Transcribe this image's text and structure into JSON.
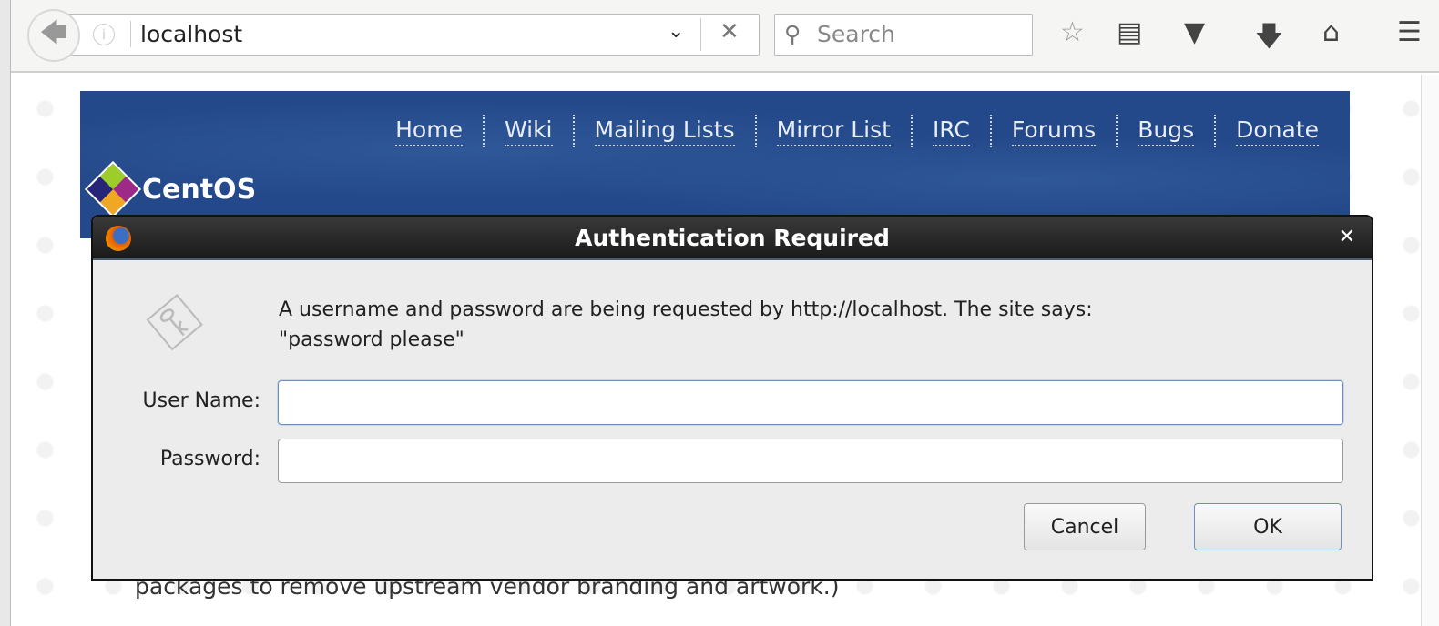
{
  "browser": {
    "url": "localhost",
    "search_placeholder": "Search",
    "icons": [
      "back-arrow-icon",
      "info-icon",
      "dropdown-icon",
      "clear-icon",
      "search-icon",
      "bookmark-star-icon",
      "reading-list-icon",
      "pocket-icon",
      "download-icon",
      "home-icon",
      "menu-icon"
    ]
  },
  "site": {
    "nav": [
      "Home",
      "Wiki",
      "Mailing Lists",
      "Mirror List",
      "IRC",
      "Forums",
      "Bugs",
      "Donate"
    ],
    "logo": "CentOS",
    "body_text": "packages to remove upstream vendor branding and artwork.)"
  },
  "dialog": {
    "title": "Authentication Required",
    "message_line1": "A username and password are being requested by http://localhost. The site says:",
    "message_line2": "\"password please\"",
    "username_label": "User Name:",
    "username_value": "",
    "password_label": "Password:",
    "password_value": "",
    "cancel": "Cancel",
    "ok": "OK"
  }
}
